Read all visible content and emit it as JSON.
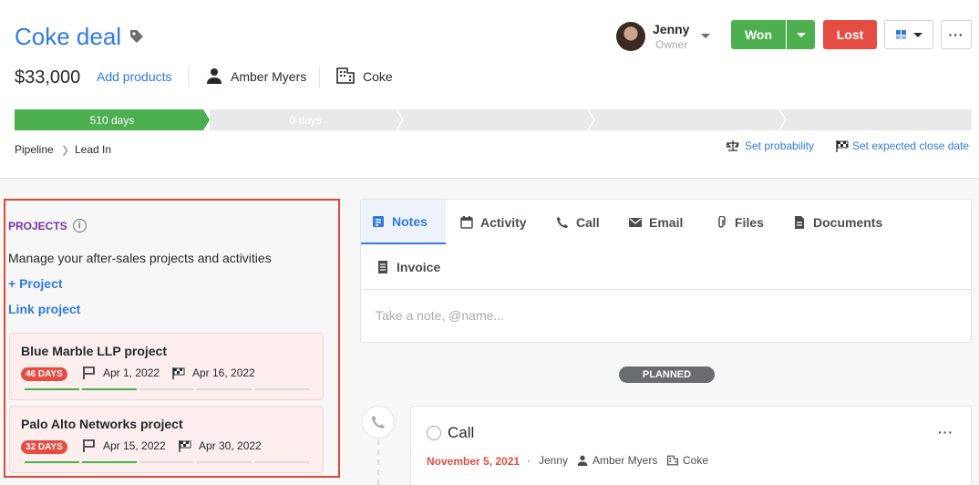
{
  "header": {
    "title": "Coke deal",
    "amount": "$33,000",
    "add_products": "Add products",
    "person": "Amber Myers",
    "organization": "Coke",
    "owner_name": "Jenny",
    "owner_role": "Owner",
    "won_label": "Won",
    "lost_label": "Lost",
    "more_label": "···"
  },
  "pipeline": {
    "stages": [
      {
        "label": "510 days",
        "active": true
      },
      {
        "label": "0 days",
        "active": false
      },
      {
        "label": "",
        "active": false
      },
      {
        "label": "",
        "active": false
      },
      {
        "label": "",
        "active": false
      }
    ],
    "breadcrumb": [
      "Pipeline",
      "Lead In"
    ],
    "set_probability": "Set probability",
    "set_close_date": "Set expected close date"
  },
  "projects": {
    "heading": "PROJECTS",
    "description": "Manage your after-sales projects and activities",
    "add_project": "+ Project",
    "link_project": "Link project",
    "items": [
      {
        "title": "Blue Marble LLP project",
        "days": "46 DAYS",
        "start": "Apr 1, 2022",
        "end": "Apr 16, 2022"
      },
      {
        "title": "Palo Alto Networks project",
        "days": "32 DAYS",
        "start": "Apr 15, 2022",
        "end": "Apr 30, 2022"
      }
    ]
  },
  "editor": {
    "tabs": [
      "Notes",
      "Activity",
      "Call",
      "Email",
      "Files",
      "Documents",
      "Invoice"
    ],
    "active_tab": "Notes",
    "placeholder": "Take a note, @name..."
  },
  "timeline": {
    "planned_label": "PLANNED",
    "activity": {
      "title": "Call",
      "date": "November 5, 2021",
      "owner": "Jenny",
      "person": "Amber Myers",
      "organization": "Coke",
      "more_label": "···"
    }
  },
  "colors": {
    "accent": "#317ae2",
    "won": "#4caf50",
    "lost": "#e54d42",
    "highlight_border": "#e04a35",
    "projects_heading": "#7734a6"
  }
}
